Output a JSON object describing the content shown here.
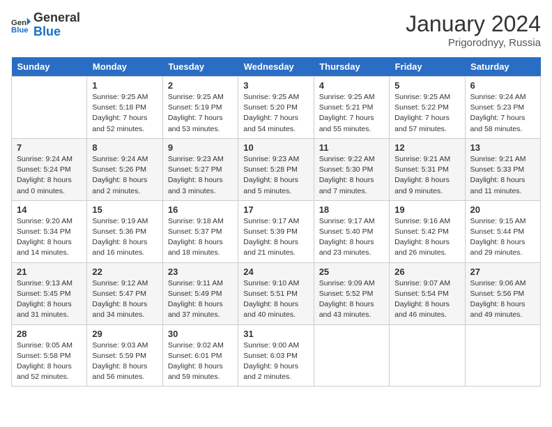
{
  "header": {
    "logo": {
      "general": "General",
      "blue": "Blue"
    },
    "title": "January 2024",
    "location": "Prigorodnyy, Russia"
  },
  "weekdays": [
    "Sunday",
    "Monday",
    "Tuesday",
    "Wednesday",
    "Thursday",
    "Friday",
    "Saturday"
  ],
  "weeks": [
    [
      {
        "day": "",
        "sunrise": "",
        "sunset": "",
        "daylight": ""
      },
      {
        "day": "1",
        "sunrise": "Sunrise: 9:25 AM",
        "sunset": "Sunset: 5:18 PM",
        "daylight": "Daylight: 7 hours and 52 minutes."
      },
      {
        "day": "2",
        "sunrise": "Sunrise: 9:25 AM",
        "sunset": "Sunset: 5:19 PM",
        "daylight": "Daylight: 7 hours and 53 minutes."
      },
      {
        "day": "3",
        "sunrise": "Sunrise: 9:25 AM",
        "sunset": "Sunset: 5:20 PM",
        "daylight": "Daylight: 7 hours and 54 minutes."
      },
      {
        "day": "4",
        "sunrise": "Sunrise: 9:25 AM",
        "sunset": "Sunset: 5:21 PM",
        "daylight": "Daylight: 7 hours and 55 minutes."
      },
      {
        "day": "5",
        "sunrise": "Sunrise: 9:25 AM",
        "sunset": "Sunset: 5:22 PM",
        "daylight": "Daylight: 7 hours and 57 minutes."
      },
      {
        "day": "6",
        "sunrise": "Sunrise: 9:24 AM",
        "sunset": "Sunset: 5:23 PM",
        "daylight": "Daylight: 7 hours and 58 minutes."
      }
    ],
    [
      {
        "day": "7",
        "sunrise": "Sunrise: 9:24 AM",
        "sunset": "Sunset: 5:24 PM",
        "daylight": "Daylight: 8 hours and 0 minutes."
      },
      {
        "day": "8",
        "sunrise": "Sunrise: 9:24 AM",
        "sunset": "Sunset: 5:26 PM",
        "daylight": "Daylight: 8 hours and 2 minutes."
      },
      {
        "day": "9",
        "sunrise": "Sunrise: 9:23 AM",
        "sunset": "Sunset: 5:27 PM",
        "daylight": "Daylight: 8 hours and 3 minutes."
      },
      {
        "day": "10",
        "sunrise": "Sunrise: 9:23 AM",
        "sunset": "Sunset: 5:28 PM",
        "daylight": "Daylight: 8 hours and 5 minutes."
      },
      {
        "day": "11",
        "sunrise": "Sunrise: 9:22 AM",
        "sunset": "Sunset: 5:30 PM",
        "daylight": "Daylight: 8 hours and 7 minutes."
      },
      {
        "day": "12",
        "sunrise": "Sunrise: 9:21 AM",
        "sunset": "Sunset: 5:31 PM",
        "daylight": "Daylight: 8 hours and 9 minutes."
      },
      {
        "day": "13",
        "sunrise": "Sunrise: 9:21 AM",
        "sunset": "Sunset: 5:33 PM",
        "daylight": "Daylight: 8 hours and 11 minutes."
      }
    ],
    [
      {
        "day": "14",
        "sunrise": "Sunrise: 9:20 AM",
        "sunset": "Sunset: 5:34 PM",
        "daylight": "Daylight: 8 hours and 14 minutes."
      },
      {
        "day": "15",
        "sunrise": "Sunrise: 9:19 AM",
        "sunset": "Sunset: 5:36 PM",
        "daylight": "Daylight: 8 hours and 16 minutes."
      },
      {
        "day": "16",
        "sunrise": "Sunrise: 9:18 AM",
        "sunset": "Sunset: 5:37 PM",
        "daylight": "Daylight: 8 hours and 18 minutes."
      },
      {
        "day": "17",
        "sunrise": "Sunrise: 9:17 AM",
        "sunset": "Sunset: 5:39 PM",
        "daylight": "Daylight: 8 hours and 21 minutes."
      },
      {
        "day": "18",
        "sunrise": "Sunrise: 9:17 AM",
        "sunset": "Sunset: 5:40 PM",
        "daylight": "Daylight: 8 hours and 23 minutes."
      },
      {
        "day": "19",
        "sunrise": "Sunrise: 9:16 AM",
        "sunset": "Sunset: 5:42 PM",
        "daylight": "Daylight: 8 hours and 26 minutes."
      },
      {
        "day": "20",
        "sunrise": "Sunrise: 9:15 AM",
        "sunset": "Sunset: 5:44 PM",
        "daylight": "Daylight: 8 hours and 29 minutes."
      }
    ],
    [
      {
        "day": "21",
        "sunrise": "Sunrise: 9:13 AM",
        "sunset": "Sunset: 5:45 PM",
        "daylight": "Daylight: 8 hours and 31 minutes."
      },
      {
        "day": "22",
        "sunrise": "Sunrise: 9:12 AM",
        "sunset": "Sunset: 5:47 PM",
        "daylight": "Daylight: 8 hours and 34 minutes."
      },
      {
        "day": "23",
        "sunrise": "Sunrise: 9:11 AM",
        "sunset": "Sunset: 5:49 PM",
        "daylight": "Daylight: 8 hours and 37 minutes."
      },
      {
        "day": "24",
        "sunrise": "Sunrise: 9:10 AM",
        "sunset": "Sunset: 5:51 PM",
        "daylight": "Daylight: 8 hours and 40 minutes."
      },
      {
        "day": "25",
        "sunrise": "Sunrise: 9:09 AM",
        "sunset": "Sunset: 5:52 PM",
        "daylight": "Daylight: 8 hours and 43 minutes."
      },
      {
        "day": "26",
        "sunrise": "Sunrise: 9:07 AM",
        "sunset": "Sunset: 5:54 PM",
        "daylight": "Daylight: 8 hours and 46 minutes."
      },
      {
        "day": "27",
        "sunrise": "Sunrise: 9:06 AM",
        "sunset": "Sunset: 5:56 PM",
        "daylight": "Daylight: 8 hours and 49 minutes."
      }
    ],
    [
      {
        "day": "28",
        "sunrise": "Sunrise: 9:05 AM",
        "sunset": "Sunset: 5:58 PM",
        "daylight": "Daylight: 8 hours and 52 minutes."
      },
      {
        "day": "29",
        "sunrise": "Sunrise: 9:03 AM",
        "sunset": "Sunset: 5:59 PM",
        "daylight": "Daylight: 8 hours and 56 minutes."
      },
      {
        "day": "30",
        "sunrise": "Sunrise: 9:02 AM",
        "sunset": "Sunset: 6:01 PM",
        "daylight": "Daylight: 8 hours and 59 minutes."
      },
      {
        "day": "31",
        "sunrise": "Sunrise: 9:00 AM",
        "sunset": "Sunset: 6:03 PM",
        "daylight": "Daylight: 9 hours and 2 minutes."
      },
      {
        "day": "",
        "sunrise": "",
        "sunset": "",
        "daylight": ""
      },
      {
        "day": "",
        "sunrise": "",
        "sunset": "",
        "daylight": ""
      },
      {
        "day": "",
        "sunrise": "",
        "sunset": "",
        "daylight": ""
      }
    ]
  ]
}
